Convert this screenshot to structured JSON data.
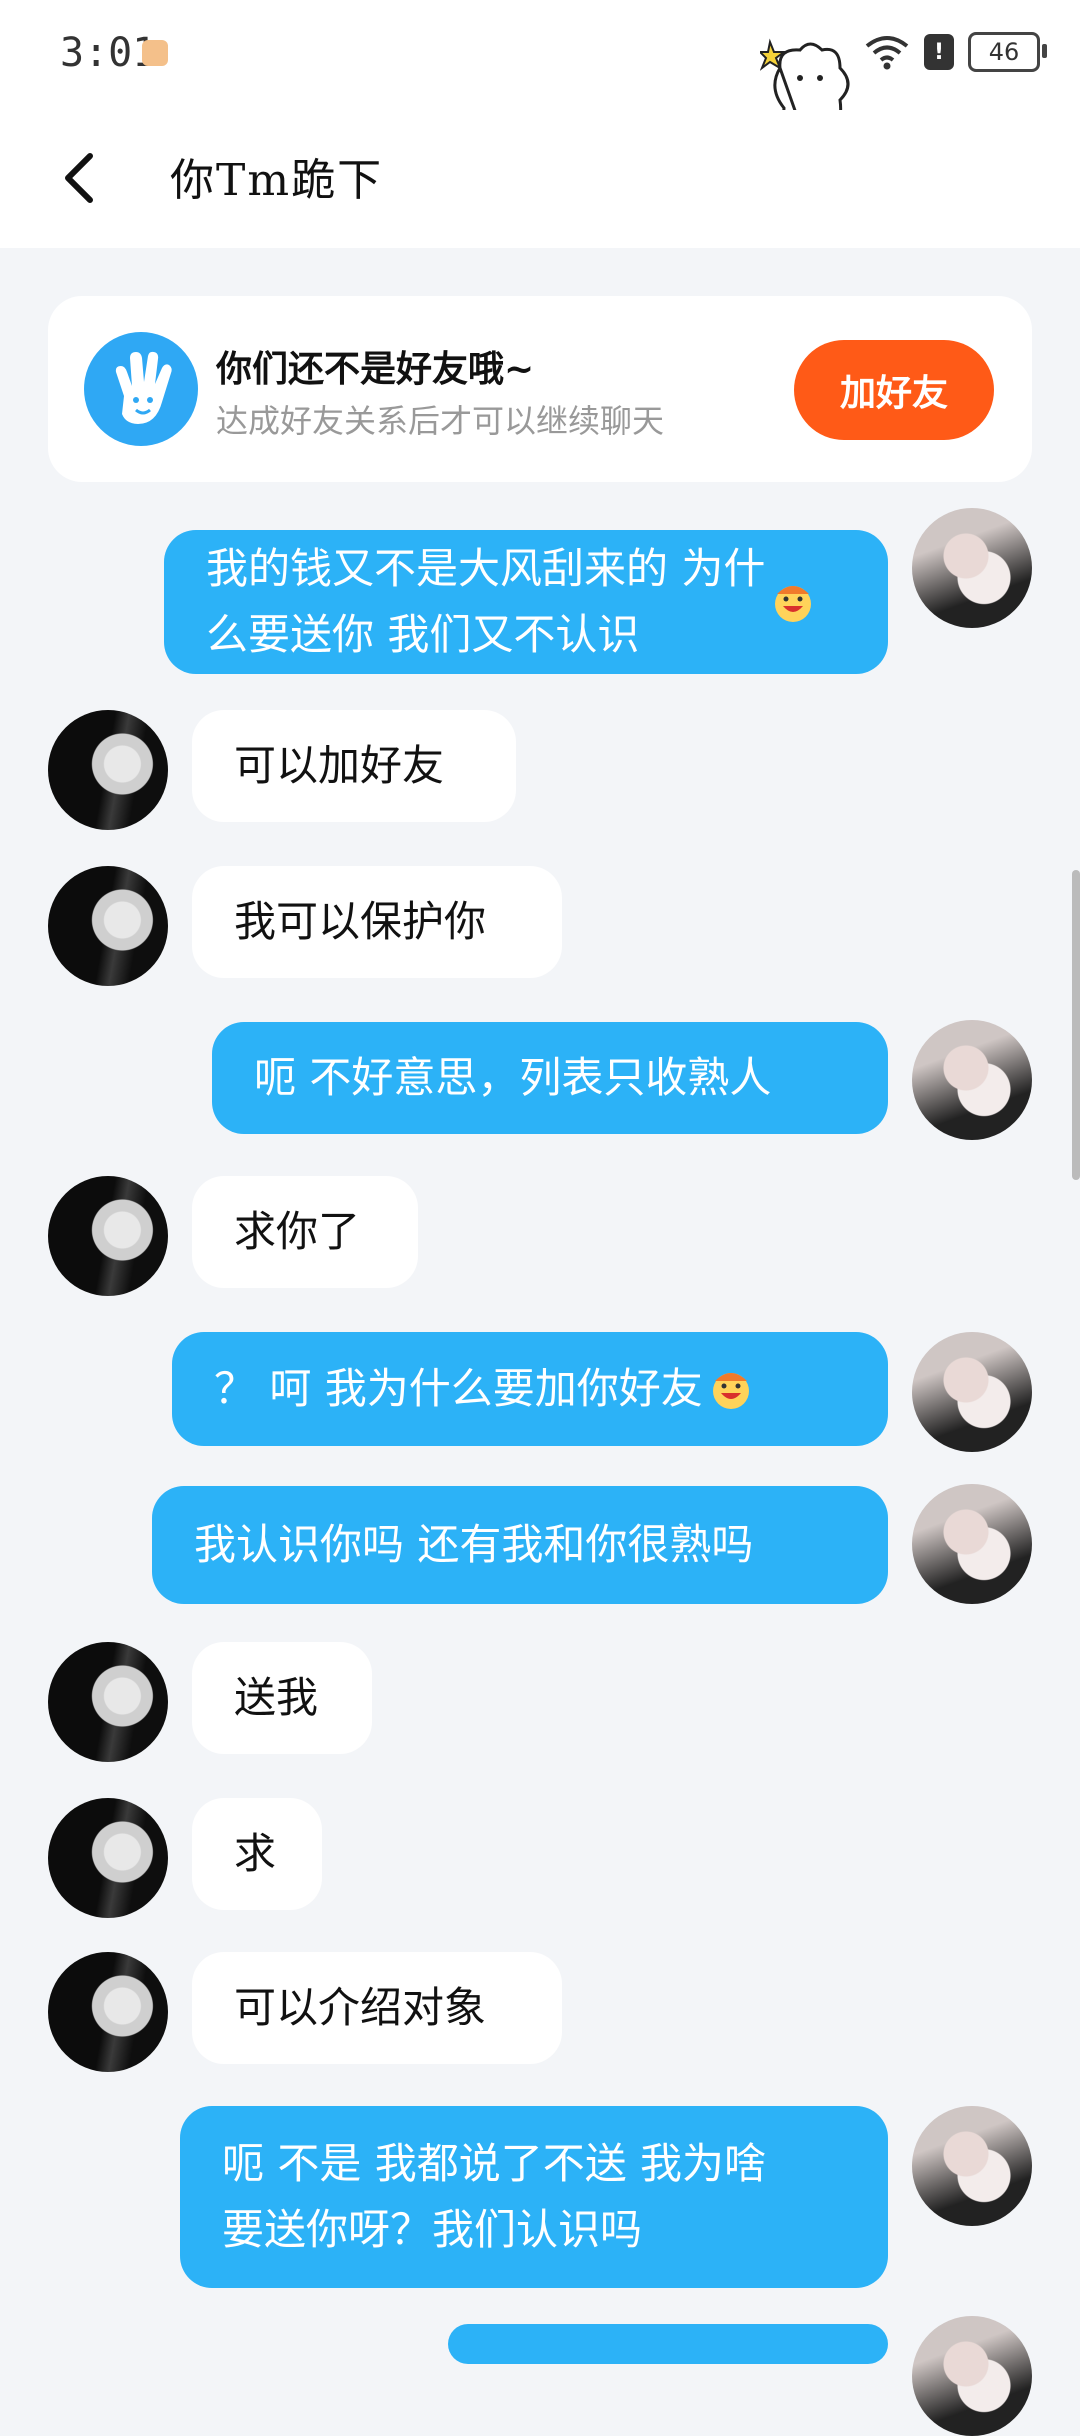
{
  "status": {
    "time": "3:01",
    "battery": "46"
  },
  "header": {
    "title": "你Tm跪下"
  },
  "friend_card": {
    "title": "你们还不是好友哦~",
    "subtitle": "达成好友关系后才可以继续聊天",
    "button": "加好友"
  },
  "messages": [
    {
      "side": "out",
      "text": "我的钱又不是大风刮来的 为什\n么要送你 我们又不认识",
      "emoji": true
    },
    {
      "side": "in",
      "text": "可以加好友"
    },
    {
      "side": "in",
      "text": "我可以保护你"
    },
    {
      "side": "out",
      "text": "呃 不好意思，列表只收熟人"
    },
    {
      "side": "in",
      "text": "求你了"
    },
    {
      "side": "out",
      "text": "？ 呵 我为什么要加你好友",
      "emoji": true
    },
    {
      "side": "out",
      "text": "我认识你吗 还有我和你很熟吗"
    },
    {
      "side": "in",
      "text": "送我"
    },
    {
      "side": "in",
      "text": "求"
    },
    {
      "side": "in",
      "text": "可以介绍对象"
    },
    {
      "side": "out",
      "text": "呃 不是 我都说了不送 我为啥\n要送你呀？我们认识吗"
    }
  ],
  "colors": {
    "accent_blue": "#2cb2f7",
    "add_friend_orange": "#ff5a17",
    "background": "#f3f5f8"
  }
}
